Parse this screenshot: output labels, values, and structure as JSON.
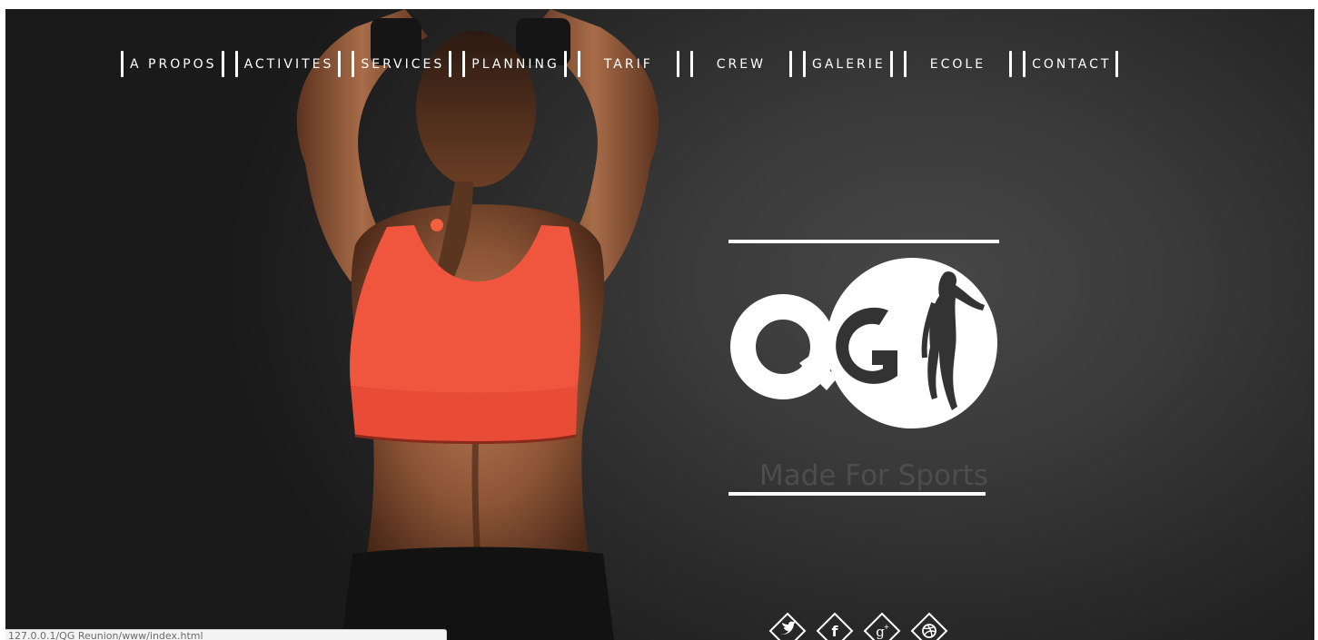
{
  "nav": {
    "items": [
      {
        "label": "A PROPOS",
        "style": "tight"
      },
      {
        "label": "ACTIVITES",
        "style": "tight"
      },
      {
        "label": "SERVICES",
        "style": "tight"
      },
      {
        "label": "PLANNING",
        "style": "tight"
      },
      {
        "label": "TARIF",
        "style": "wide"
      },
      {
        "label": "CREW",
        "style": "wide"
      },
      {
        "label": "GALERIE",
        "style": "tight"
      },
      {
        "label": "ECOLE",
        "style": "wide"
      },
      {
        "label": "CONTACT",
        "style": "tight"
      }
    ]
  },
  "hero": {
    "logo_text": "QG",
    "tagline": "Made For Sports"
  },
  "social": {
    "icons": [
      {
        "name": "twitter-icon",
        "glyph": "🐦"
      },
      {
        "name": "facebook-icon",
        "glyph": "f"
      },
      {
        "name": "google-plus-icon",
        "glyph": "g+"
      },
      {
        "name": "dribbble-icon",
        "glyph": "◎"
      }
    ]
  },
  "status_bar": {
    "url": "127.0.0.1/QG Reunion/www/index.html"
  },
  "colors": {
    "top_orange": "#f0553d",
    "background": "#2f2f2f",
    "white": "#ffffff"
  }
}
